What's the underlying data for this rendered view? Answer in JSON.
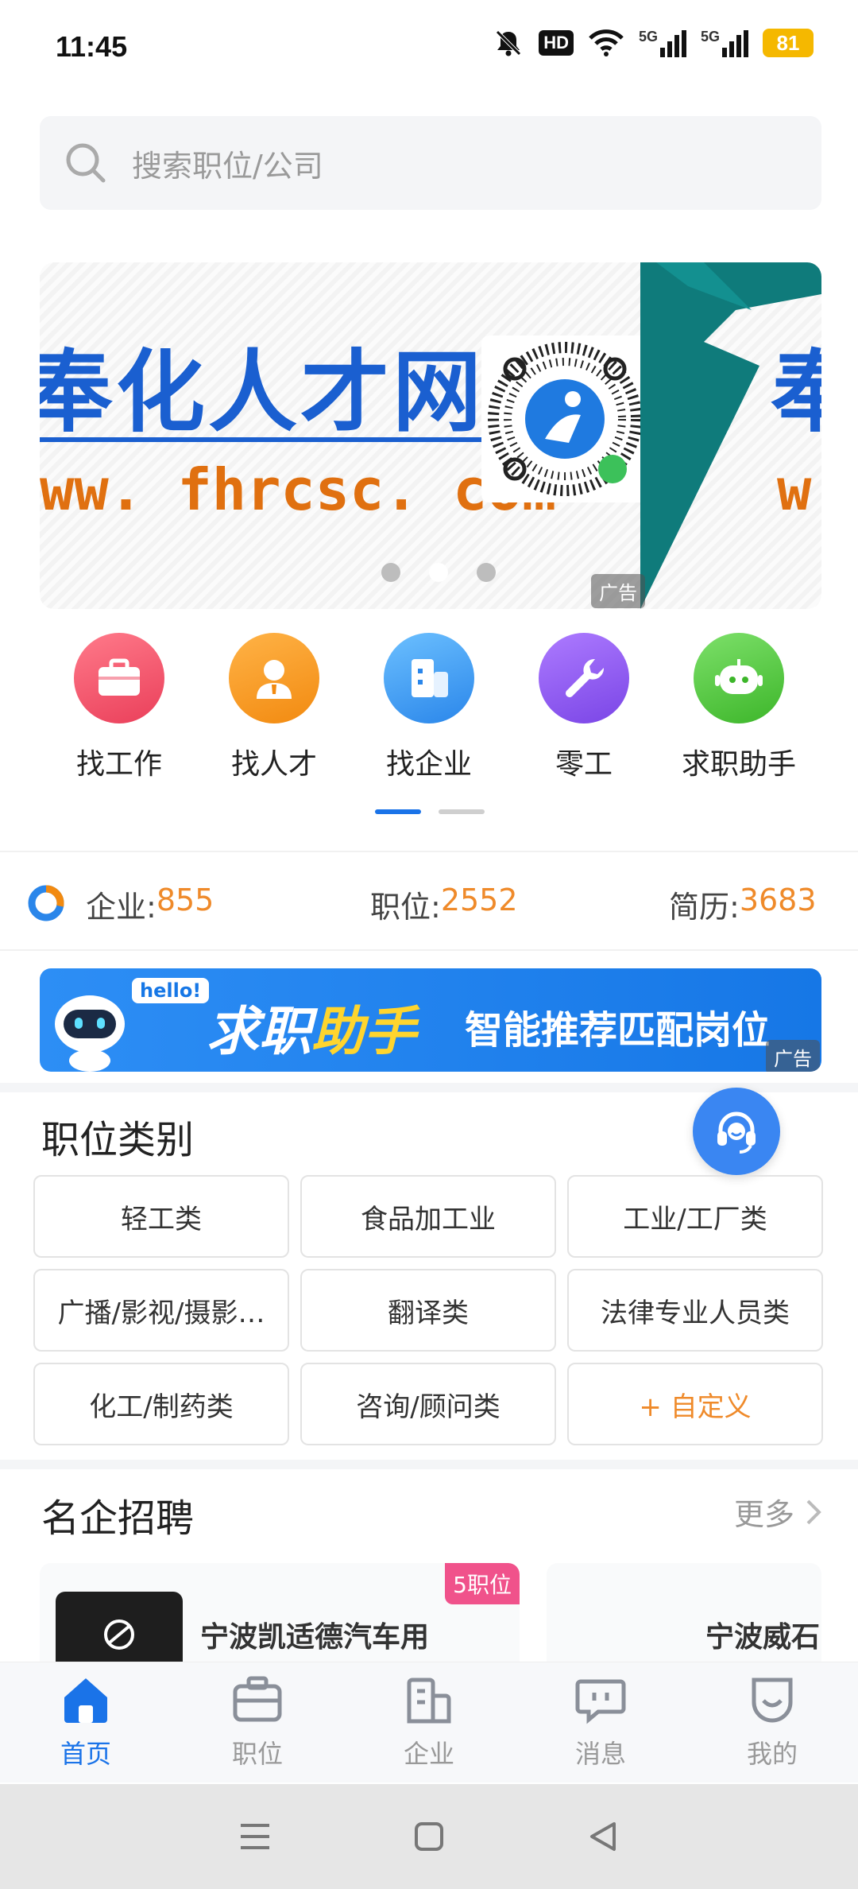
{
  "status": {
    "time": "11:45",
    "battery": "81",
    "hd": "HD",
    "net1": "5G",
    "net2": "5G"
  },
  "search": {
    "placeholder": "搜索职位/公司"
  },
  "banner": {
    "title": "奉化人才网",
    "url": "ww. fhrcsc. com",
    "ad": "广告",
    "slides": 3,
    "active_slide": 2
  },
  "quick_nav": [
    {
      "label": "找工作",
      "icon": "briefcase-icon",
      "color": "#f0556b"
    },
    {
      "label": "找人才",
      "icon": "person-icon",
      "color": "#f59a23"
    },
    {
      "label": "找企业",
      "icon": "building-icon",
      "color": "#3a9cf2"
    },
    {
      "label": "零工",
      "icon": "wrench-icon",
      "color": "#8b5cf0"
    },
    {
      "label": "求职助手",
      "icon": "robot-icon",
      "color": "#4cc440"
    }
  ],
  "stats": {
    "company_label": "企业:",
    "company_value": "855",
    "job_label": "职位:",
    "job_value": "2552",
    "resume_label": "简历:",
    "resume_value": "3683"
  },
  "assistant_banner": {
    "hello": "hello!",
    "title_a": "求职",
    "title_b": "助手",
    "subtitle": "智能推荐匹配岗位",
    "ad": "广告"
  },
  "categories": {
    "title": "职位类别",
    "items": [
      "轻工类",
      "食品加工业",
      "工业/工厂类",
      "广播/影视/摄影…",
      "翻译类",
      "法律专业人员类",
      "化工/制药类",
      "咨询/顾问类"
    ],
    "custom": "+ 自定义"
  },
  "famous": {
    "title": "名企招聘",
    "more": "更多",
    "companies": [
      {
        "name": "宁波凯适德汽车用",
        "badge": "5职位"
      },
      {
        "name": "宁波威石",
        "badge": ""
      }
    ]
  },
  "tabs": [
    {
      "label": "首页",
      "icon": "home-icon",
      "active": true
    },
    {
      "label": "职位",
      "icon": "briefcase-tab-icon",
      "active": false
    },
    {
      "label": "企业",
      "icon": "building-tab-icon",
      "active": false
    },
    {
      "label": "消息",
      "icon": "message-icon",
      "active": false
    },
    {
      "label": "我的",
      "icon": "profile-icon",
      "active": false
    }
  ],
  "colors": {
    "accent": "#1a73e8",
    "orange": "#ef8a2a",
    "pink": "#f0528b"
  }
}
